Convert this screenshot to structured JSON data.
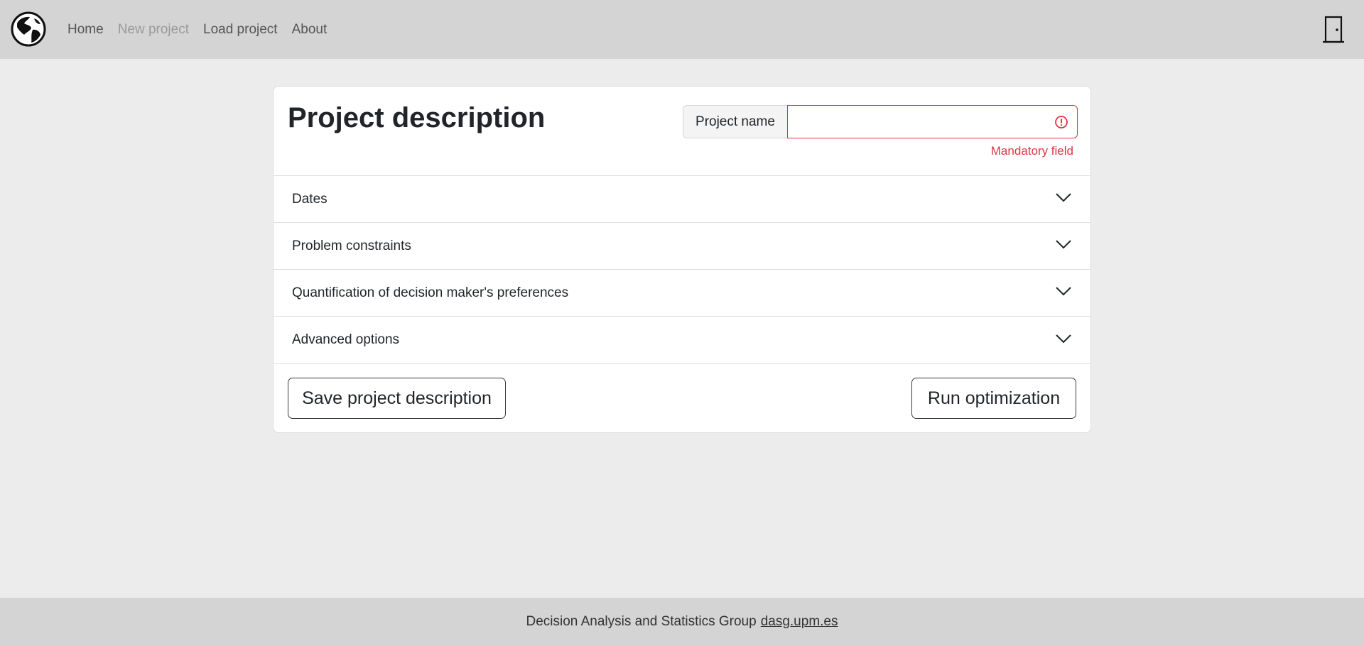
{
  "nav": {
    "brand_icon": "globe-icon",
    "links": [
      {
        "label": "Home",
        "disabled": false
      },
      {
        "label": "New project",
        "disabled": true
      },
      {
        "label": "Load project",
        "disabled": false
      },
      {
        "label": "About",
        "disabled": false
      }
    ],
    "exit_icon": "door-exit-icon"
  },
  "card": {
    "title": "Project description",
    "project_name": {
      "label": "Project name",
      "value": "",
      "placeholder": "",
      "error_icon": "exclamation-circle-icon",
      "feedback": "Mandatory field",
      "error_color": "#dc3545"
    },
    "accordion": [
      {
        "label": "Dates",
        "icon": "chevron-down-icon"
      },
      {
        "label": "Problem constraints",
        "icon": "chevron-down-icon"
      },
      {
        "label": "Quantification of decision maker's preferences",
        "icon": "chevron-down-icon"
      },
      {
        "label": "Advanced options",
        "icon": "chevron-down-icon"
      }
    ],
    "save_button": "Save project description",
    "run_button": "Run optimization"
  },
  "footer": {
    "text": "Decision Analysis and Statistics Group",
    "link": "dasg.upm.es"
  }
}
